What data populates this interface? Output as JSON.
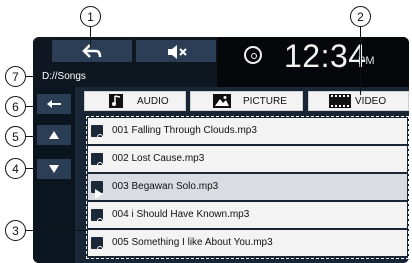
{
  "status": {
    "time": "12:34",
    "ampm": "PM"
  },
  "path": {
    "text": "D://Songs"
  },
  "tabs": [
    {
      "label": "AUDIO",
      "icon": "music-note-icon"
    },
    {
      "label": "PICTURE",
      "icon": "picture-icon"
    },
    {
      "label": "VIDEO",
      "icon": "film-icon"
    }
  ],
  "files": [
    {
      "name": "001  Falling Through Clouds.mp3"
    },
    {
      "name": "002  Lost Cause.mp3"
    },
    {
      "name": "003  Begawan Solo.mp3"
    },
    {
      "name": "004  i Should Have Known.mp3"
    },
    {
      "name": "005  Something I like About You.mp3"
    }
  ],
  "callouts": [
    {
      "number": "1"
    },
    {
      "number": "2"
    },
    {
      "number": "3"
    },
    {
      "number": "4"
    },
    {
      "number": "5"
    },
    {
      "number": "6"
    },
    {
      "number": "7"
    }
  ],
  "colors": {
    "screen_bg": "#1b2838",
    "button_bg": "#2c3e55",
    "row_bg": "#f3f3f3",
    "selected_row_bg": "#d9dde3"
  }
}
